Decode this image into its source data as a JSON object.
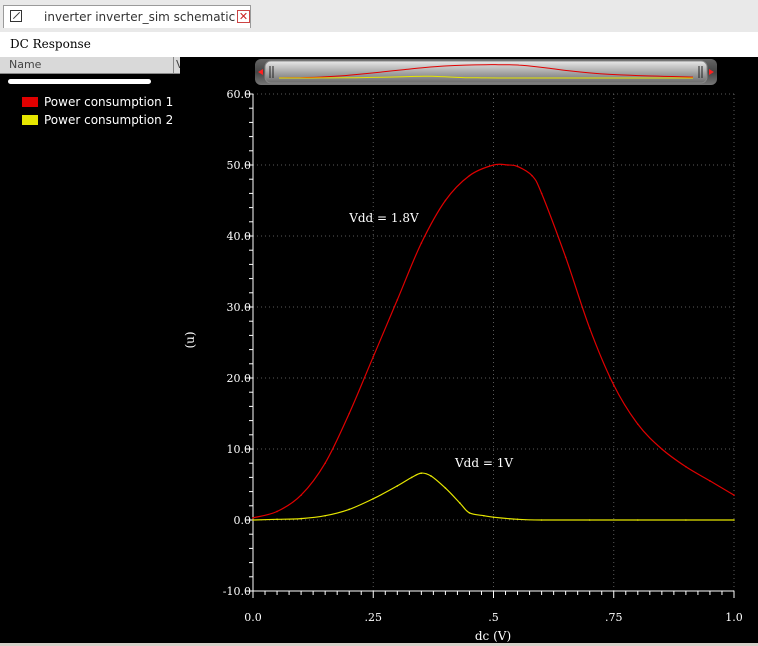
{
  "window": {
    "tab_title": "inverter inverter_sim schematic",
    "tab_icon": "schematic-icon",
    "close_icon": "close-icon",
    "close_glyph": "✕"
  },
  "panel": {
    "title": "DC Response"
  },
  "sidebar": {
    "column_name": "Name",
    "column_value": "V"
  },
  "legend": [
    {
      "label": "Power consumption 1",
      "color": "#e00000"
    },
    {
      "label": "Power consumption 2",
      "color": "#e6e600"
    }
  ],
  "chart_data": {
    "type": "line",
    "xlabel": "dc (V)",
    "ylabel": "(u)",
    "xlim": [
      0.0,
      1.0
    ],
    "ylim": [
      -10.0,
      60.0
    ],
    "xticks": [
      0.0,
      0.25,
      0.5,
      0.75,
      1.0
    ],
    "xtick_labels": [
      "0.0",
      ".25",
      ".5",
      ".75",
      "1.0"
    ],
    "yticks": [
      -10,
      0,
      10,
      20,
      30,
      40,
      50,
      60
    ],
    "ytick_labels": [
      "-10.0",
      "0.0",
      "10.0",
      "20.0",
      "30.0",
      "40.0",
      "50.0",
      "60.0"
    ],
    "grid": true,
    "annotations": [
      {
        "text": "Vdd = 1.8V",
        "x": 0.2,
        "y": 42.0
      },
      {
        "text": "Vdd = 1V",
        "x": 0.42,
        "y": 7.5
      }
    ],
    "series": [
      {
        "name": "Power consumption 1",
        "color": "#e00000",
        "x": [
          0.0,
          0.05,
          0.1,
          0.15,
          0.2,
          0.25,
          0.3,
          0.35,
          0.4,
          0.45,
          0.5,
          0.53,
          0.55,
          0.58,
          0.6,
          0.65,
          0.7,
          0.75,
          0.8,
          0.85,
          0.9,
          0.95,
          1.0
        ],
        "values": [
          0.3,
          1.2,
          3.5,
          8.0,
          15.0,
          23.0,
          31.0,
          39.0,
          45.0,
          48.5,
          50.0,
          50.0,
          49.8,
          48.5,
          46.0,
          37.0,
          27.0,
          19.0,
          13.5,
          10.0,
          7.5,
          5.5,
          3.5
        ]
      },
      {
        "name": "Power consumption 2",
        "color": "#e6e600",
        "x": [
          0.0,
          0.05,
          0.1,
          0.15,
          0.2,
          0.25,
          0.3,
          0.33,
          0.35,
          0.37,
          0.4,
          0.43,
          0.45,
          0.48,
          0.5,
          0.55,
          0.6,
          0.7,
          0.8,
          0.9,
          1.0
        ],
        "values": [
          0.0,
          0.1,
          0.2,
          0.6,
          1.5,
          3.0,
          4.8,
          6.0,
          6.6,
          6.2,
          4.5,
          2.4,
          1.0,
          0.6,
          0.4,
          0.1,
          0.0,
          0.0,
          0.0,
          0.0,
          0.0
        ]
      }
    ]
  }
}
